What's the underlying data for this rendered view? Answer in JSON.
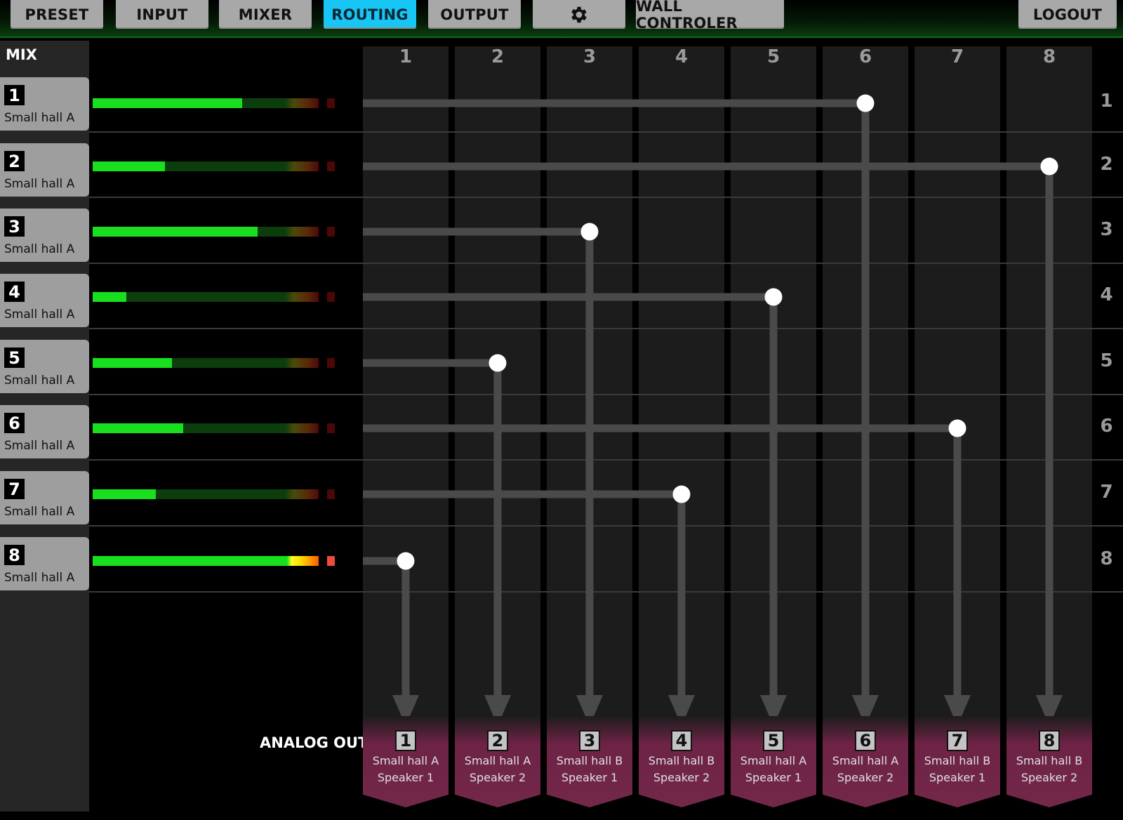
{
  "nav": {
    "preset": "PRESET",
    "input": "INPUT",
    "mixer": "MIXER",
    "routing": "ROUTING",
    "output": "OUTPUT",
    "settings_icon": "gear-icon",
    "wall": "WALL CONTROLER",
    "logout": "LOGOUT",
    "active_tab": "ROUTING"
  },
  "mix": {
    "header": "MIX",
    "items": [
      {
        "num": "1",
        "name": "Small hall A",
        "level": 0.66,
        "clip": false
      },
      {
        "num": "2",
        "name": "Small hall A",
        "level": 0.32,
        "clip": false
      },
      {
        "num": "3",
        "name": "Small hall A",
        "level": 0.73,
        "clip": false
      },
      {
        "num": "4",
        "name": "Small hall A",
        "level": 0.15,
        "clip": false
      },
      {
        "num": "5",
        "name": "Small hall A",
        "level": 0.35,
        "clip": false
      },
      {
        "num": "6",
        "name": "Small hall A",
        "level": 0.4,
        "clip": false
      },
      {
        "num": "7",
        "name": "Small hall A",
        "level": 0.28,
        "clip": false
      },
      {
        "num": "8",
        "name": "Small hall A",
        "level": 1.0,
        "clip": true
      }
    ]
  },
  "grid": {
    "column_headers": [
      "1",
      "2",
      "3",
      "4",
      "5",
      "6",
      "7",
      "8"
    ],
    "row_labels": [
      "1",
      "2",
      "3",
      "4",
      "5",
      "6",
      "7",
      "8"
    ]
  },
  "routing": [
    {
      "mix": 1,
      "output": 6
    },
    {
      "mix": 2,
      "output": 8
    },
    {
      "mix": 3,
      "output": 3
    },
    {
      "mix": 4,
      "output": 5
    },
    {
      "mix": 5,
      "output": 2
    },
    {
      "mix": 6,
      "output": 7
    },
    {
      "mix": 7,
      "output": 4
    },
    {
      "mix": 8,
      "output": 1
    }
  ],
  "analog_out": {
    "label": "ANALOG OUT",
    "outputs": [
      {
        "num": "1",
        "line1": "Small hall A",
        "line2": "Speaker 1"
      },
      {
        "num": "2",
        "line1": "Small hall A",
        "line2": "Speaker 2"
      },
      {
        "num": "3",
        "line1": "Small hall B",
        "line2": "Speaker 1"
      },
      {
        "num": "4",
        "line1": "Small hall B",
        "line2": "Speaker 2"
      },
      {
        "num": "5",
        "line1": "Small hall A",
        "line2": "Speaker 1"
      },
      {
        "num": "6",
        "line1": "Small hall A",
        "line2": "Speaker 2"
      },
      {
        "num": "7",
        "line1": "Small hall B",
        "line2": "Speaker 1"
      },
      {
        "num": "8",
        "line1": "Small hall B",
        "line2": "Speaker 2"
      }
    ]
  },
  "colors": {
    "active_tab": "#18c6f5",
    "meter_green": "#18e01e",
    "route_line": "#4a4a4a",
    "output_bg": "#73284a"
  }
}
